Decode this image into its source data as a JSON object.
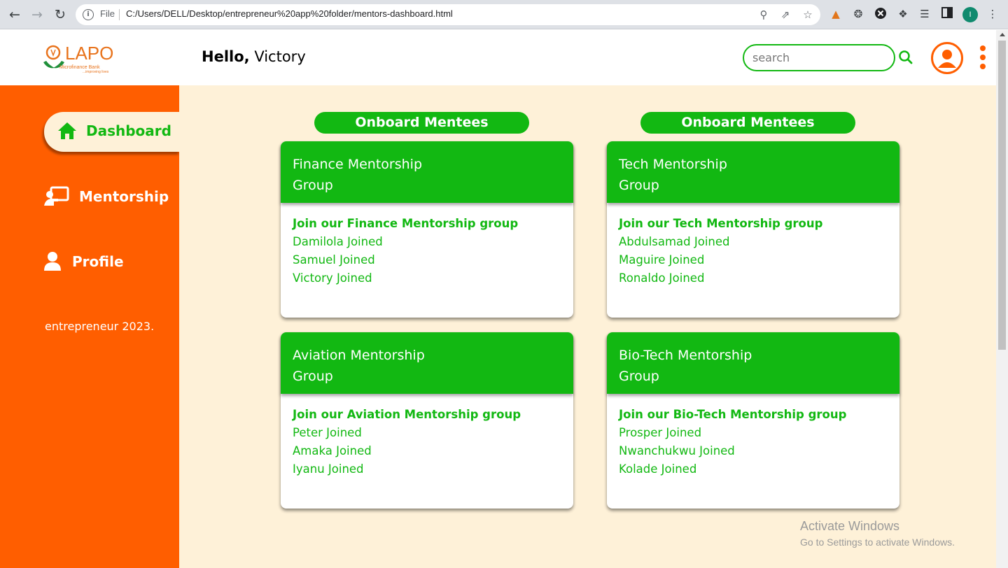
{
  "browser": {
    "scheme_label": "File",
    "url": "C:/Users/DELL/Desktop/entrepreneur%20app%20folder/mentors-dashboard.html",
    "profile_initial": "I"
  },
  "header": {
    "logo_text": "LAPO",
    "logo_subtext": "Microfinance Bank",
    "logo_tagline": "...improving lives",
    "greeting_prefix": "Hello,",
    "greeting_name": "Victory",
    "search_placeholder": "search"
  },
  "sidebar": {
    "items": [
      {
        "label": "Dashboard",
        "icon": "home-icon",
        "active": true
      },
      {
        "label": "Mentorship",
        "icon": "mentorship-icon",
        "active": false
      },
      {
        "label": "Profile",
        "icon": "user-icon",
        "active": false
      }
    ],
    "footer": "entrepreneur 2023."
  },
  "main": {
    "columns": [
      {
        "heading": "Onboard Mentees"
      },
      {
        "heading": "Onboard Mentees"
      }
    ],
    "groups": [
      {
        "title_line1": "Finance Mentorship",
        "title_line2": "Group",
        "join_text": "Join our Finance Mentorship group",
        "members": [
          "Damilola Joined",
          "Samuel Joined",
          "Victory Joined"
        ]
      },
      {
        "title_line1": "Tech Mentorship",
        "title_line2": "Group",
        "join_text": "Join our Tech Mentorship group",
        "members": [
          "Abdulsamad Joined",
          "Maguire Joined",
          "Ronaldo Joined"
        ]
      },
      {
        "title_line1": "Aviation Mentorship",
        "title_line2": "Group",
        "join_text": "Join our Aviation Mentorship group",
        "members": [
          "Peter Joined",
          "Amaka Joined",
          "Iyanu Joined"
        ]
      },
      {
        "title_line1": "Bio-Tech Mentorship",
        "title_line2": "Group",
        "join_text": "Join our Bio-Tech Mentorship group",
        "members": [
          "Prosper Joined",
          "Nwanchukwu Joined",
          "Kolade Joined"
        ]
      }
    ]
  },
  "watermark": {
    "title": "Activate Windows",
    "subtitle": "Go to Settings to activate Windows."
  },
  "colors": {
    "accent_orange": "#ff5e00",
    "accent_green": "#12b812",
    "background_cream": "#fef1d8"
  }
}
